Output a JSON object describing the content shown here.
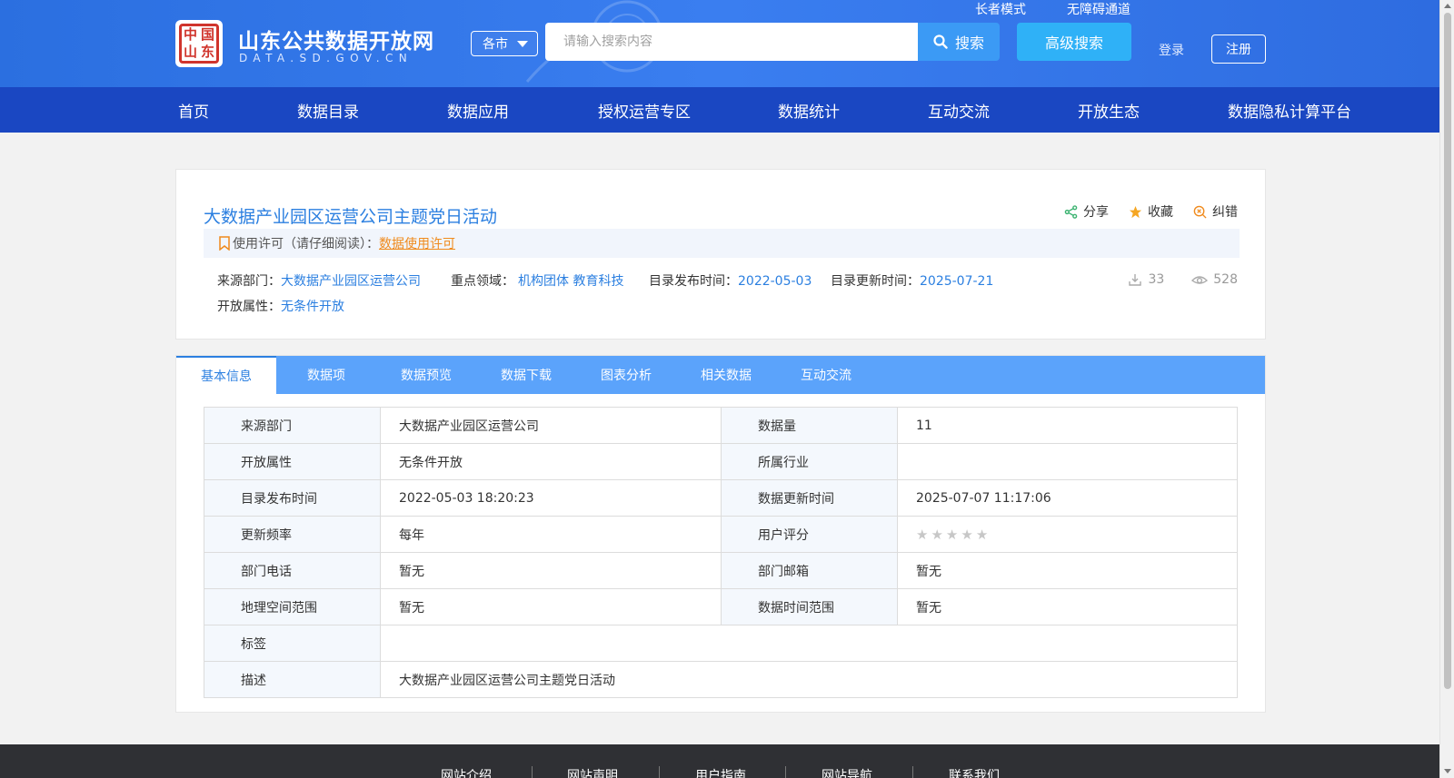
{
  "header": {
    "site_title": "山东公共数据开放网",
    "site_subtitle": "DATA.SD.GOV.CN",
    "seal_chars": [
      "中",
      "国",
      "山",
      "东"
    ],
    "elder_mode": "长者模式",
    "accessibility": "无障碍通道",
    "city": "各市",
    "search_placeholder": "请输入搜索内容",
    "search_label": "搜索",
    "advanced_search_label": "高级搜索",
    "login_label": "登录",
    "register_label": "注册"
  },
  "nav": {
    "items": [
      "首页",
      "数据目录",
      "数据应用",
      "授权运营专区",
      "数据统计",
      "互动交流",
      "开放生态",
      "数据隐私计算平台"
    ]
  },
  "dataset": {
    "title": "大数据产业园区运营公司主题党日活动",
    "actions": {
      "share": "分享",
      "favorite": "收藏",
      "report": "纠错"
    },
    "license_label": "使用许可（请仔细阅读）：",
    "license_link": "数据使用许可",
    "source_dept_label": "来源部门：",
    "source_dept": "大数据产业园区运营公司",
    "domain_label": "重点领域：",
    "domains": "机构团体 教育科技",
    "publish_label": "目录发布时间：",
    "publish_date": "2022-05-03",
    "update_label": "目录更新时间：",
    "update_date": "2025-07-21",
    "open_attr_label": "开放属性：",
    "open_attr": "无条件开放",
    "downloads": "33",
    "views": "528"
  },
  "tabs": [
    "基本信息",
    "数据项",
    "数据预览",
    "数据下载",
    "图表分析",
    "相关数据",
    "互动交流"
  ],
  "info_table": {
    "rows": [
      [
        "来源部门",
        "大数据产业园区运营公司",
        "数据量",
        "11"
      ],
      [
        "开放属性",
        "无条件开放",
        "所属行业",
        ""
      ],
      [
        "目录发布时间",
        "2022-05-03 18:20:23",
        "数据更新时间",
        "2025-07-07 11:17:06"
      ],
      [
        "更新频率",
        "每年",
        "用户评分",
        ""
      ],
      [
        "部门电话",
        "暂无",
        "部门邮箱",
        "暂无"
      ],
      [
        "地理空间范围",
        "暂无",
        "数据时间范围",
        "暂无"
      ]
    ],
    "tag_label": "标签",
    "tag_value": "",
    "desc_label": "描述",
    "desc_value": "大数据产业园区运营公司主题党日活动",
    "rating_stars": 0
  },
  "footer": {
    "links": [
      "网站介绍",
      "网站声明",
      "用户指南",
      "网站导航",
      "联系我们"
    ]
  },
  "colors": {
    "header_blue": "#2b6fe0",
    "nav_blue": "#1a47c2",
    "tab_blue": "#5ba3fb",
    "link_blue": "#2b7fe0",
    "license_orange": "#f08a1c"
  }
}
